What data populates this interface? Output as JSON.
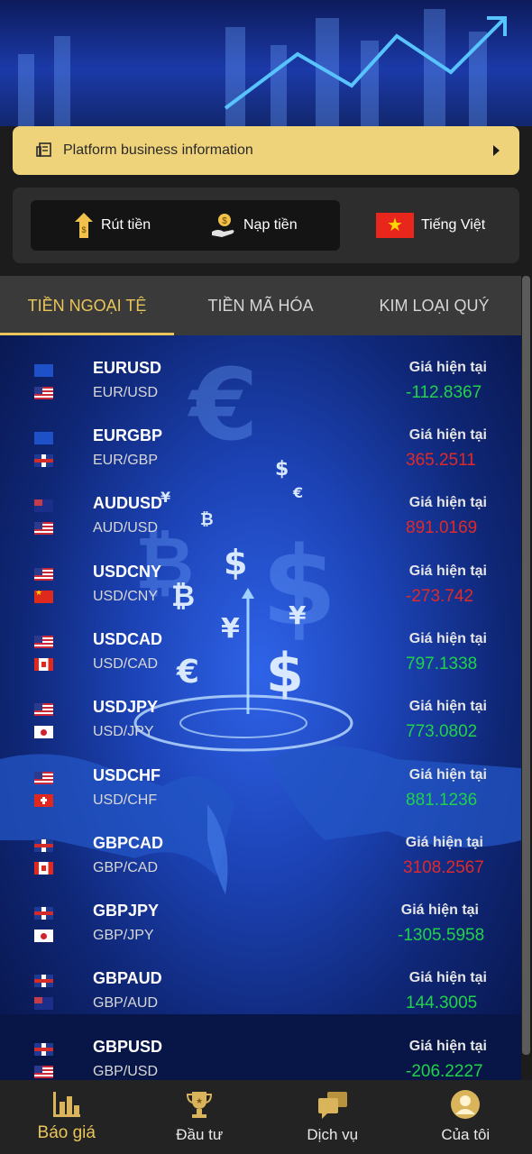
{
  "notice": {
    "text": "Platform business information"
  },
  "quick_actions": {
    "withdraw": "Rút tiền",
    "deposit": "Nạp tiền",
    "language": "Tiếng Việt"
  },
  "tabs": [
    {
      "label": "TIỀN NGOẠI TỆ",
      "active": true
    },
    {
      "label": "TIỀN MÃ HÓA",
      "active": false
    },
    {
      "label": "KIM LOẠI QUÝ",
      "active": false
    }
  ],
  "colors": {
    "accent": "#eac55a",
    "up": "#20d24a",
    "down": "#e02a2a",
    "notice_bg": "#efd37a"
  },
  "quotes": [
    {
      "symbol": "EURUSD",
      "pair": "EUR/USD",
      "label": "Giá hiện tại",
      "price": "-112.8367",
      "trend": "up",
      "flag1": "eu",
      "flag2": "us"
    },
    {
      "symbol": "EURGBP",
      "pair": "EUR/GBP",
      "label": "Giá hiện tại",
      "price": "365.2511",
      "trend": "down",
      "flag1": "eu",
      "flag2": "gb"
    },
    {
      "symbol": "AUDUSD",
      "pair": "AUD/USD",
      "label": "Giá hiện tại",
      "price": "891.0169",
      "trend": "down",
      "flag1": "au",
      "flag2": "us"
    },
    {
      "symbol": "USDCNY",
      "pair": "USD/CNY",
      "label": "Giá hiện tại",
      "price": "-273.742",
      "trend": "down",
      "flag1": "us",
      "flag2": "cn"
    },
    {
      "symbol": "USDCAD",
      "pair": "USD/CAD",
      "label": "Giá hiện tại",
      "price": "797.1338",
      "trend": "up",
      "flag1": "us",
      "flag2": "ca"
    },
    {
      "symbol": "USDJPY",
      "pair": "USD/JPY",
      "label": "Giá hiện tại",
      "price": "773.0802",
      "trend": "up",
      "flag1": "us",
      "flag2": "jp"
    },
    {
      "symbol": "USDCHF",
      "pair": "USD/CHF",
      "label": "Giá hiện tại",
      "price": "881.1236",
      "trend": "up",
      "flag1": "us",
      "flag2": "ch"
    },
    {
      "symbol": "GBPCAD",
      "pair": "GBP/CAD",
      "label": "Giá hiện tại",
      "price": "3108.2567",
      "trend": "down",
      "flag1": "gb",
      "flag2": "ca"
    },
    {
      "symbol": "GBPJPY",
      "pair": "GBP/JPY",
      "label": "Giá hiện tại",
      "price": "-1305.5958",
      "trend": "up",
      "flag1": "gb",
      "flag2": "jp"
    },
    {
      "symbol": "GBPAUD",
      "pair": "GBP/AUD",
      "label": "Giá hiện tại",
      "price": "144.3005",
      "trend": "up",
      "flag1": "gb",
      "flag2": "au"
    },
    {
      "symbol": "GBPUSD",
      "pair": "GBP/USD",
      "label": "Giá hiện tại",
      "price": "-206.2227",
      "trend": "up",
      "flag1": "gb",
      "flag2": "us"
    }
  ],
  "nav": [
    {
      "label": "Báo giá",
      "icon": "bar-chart-icon",
      "active": true
    },
    {
      "label": "Đầu tư",
      "icon": "trophy-icon",
      "active": false
    },
    {
      "label": "Dịch vụ",
      "icon": "chat-icon",
      "active": false
    },
    {
      "label": "Của tôi",
      "icon": "user-icon",
      "active": false
    }
  ]
}
